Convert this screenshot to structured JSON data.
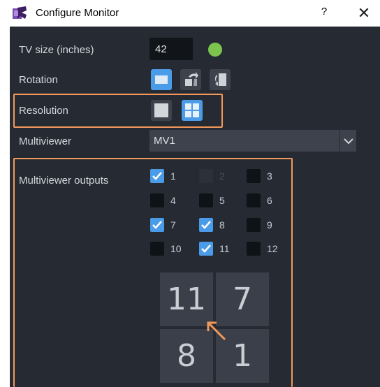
{
  "window": {
    "title": "Configure Monitor",
    "help": "?",
    "close": "✕"
  },
  "tv_size": {
    "label": "TV size (inches)",
    "value": "42",
    "status_color": "#7cc44e"
  },
  "rotation": {
    "label": "Rotation",
    "selected": "landscape",
    "options": [
      "landscape",
      "rotate-right",
      "portrait"
    ]
  },
  "resolution": {
    "label": "Resolution",
    "selected": "quad",
    "options": [
      "single",
      "quad"
    ]
  },
  "multiviewer": {
    "label": "Multiviewer",
    "value": "MV1"
  },
  "outputs": {
    "label": "Multiviewer outputs",
    "items": [
      {
        "num": "1",
        "state": "checked"
      },
      {
        "num": "2",
        "state": "disabled"
      },
      {
        "num": "3",
        "state": "unchecked"
      },
      {
        "num": "4",
        "state": "unchecked"
      },
      {
        "num": "5",
        "state": "unchecked"
      },
      {
        "num": "6",
        "state": "unchecked"
      },
      {
        "num": "7",
        "state": "checked"
      },
      {
        "num": "8",
        "state": "checked"
      },
      {
        "num": "9",
        "state": "unchecked"
      },
      {
        "num": "10",
        "state": "unchecked"
      },
      {
        "num": "11",
        "state": "checked"
      },
      {
        "num": "12",
        "state": "unchecked"
      }
    ]
  },
  "layout_tiles": [
    "11",
    "7",
    "8",
    "1"
  ],
  "colors": {
    "accent": "#4a9be8",
    "highlight": "#f2985a",
    "panel": "#262a33"
  }
}
